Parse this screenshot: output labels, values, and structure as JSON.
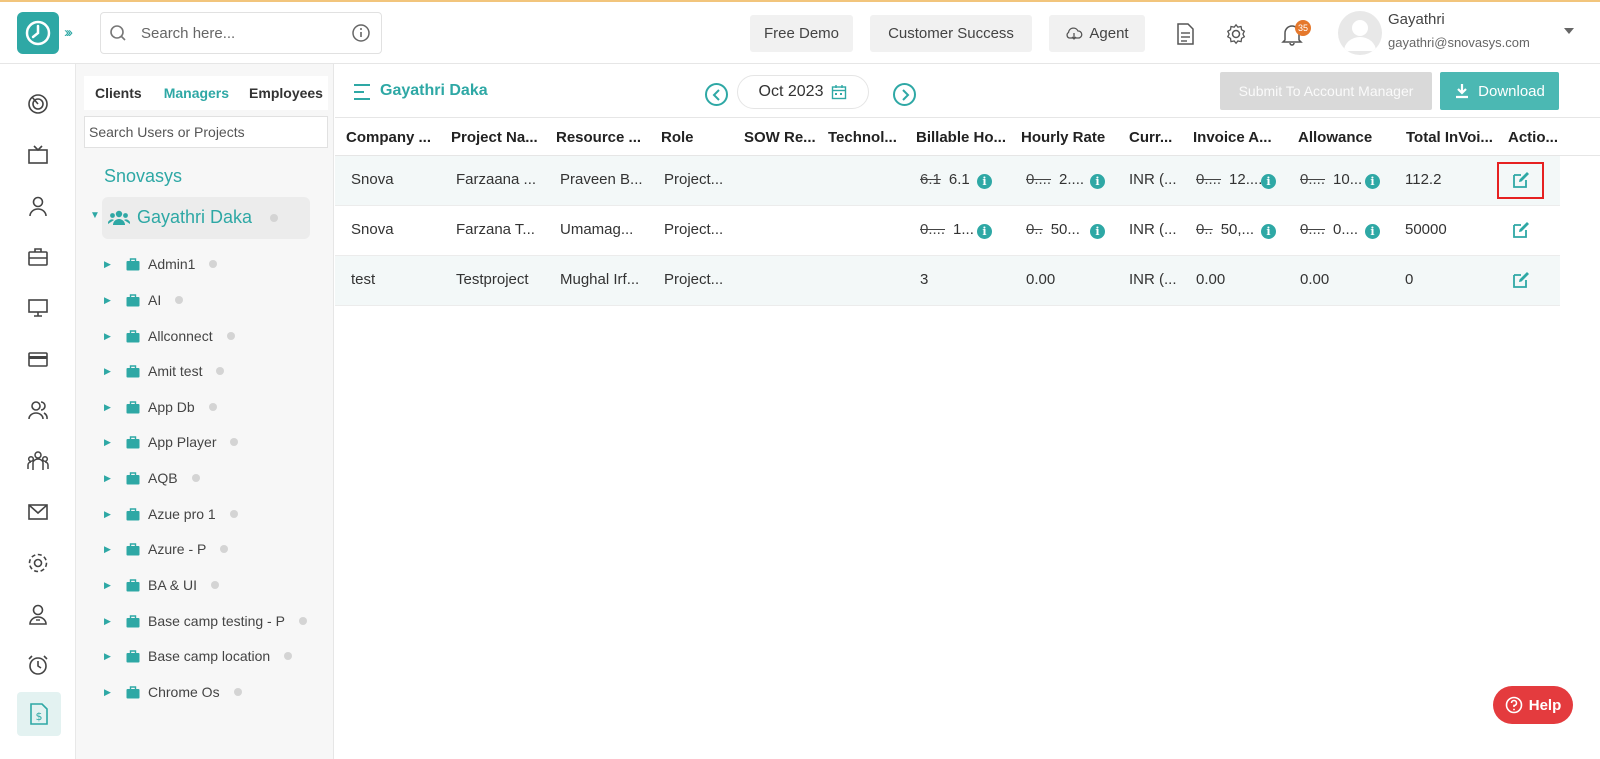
{
  "topbar": {
    "search_placeholder": "Search here...",
    "free_demo": "Free Demo",
    "customer_success": "Customer Success",
    "agent": "Agent",
    "notification_count": "35",
    "user_name": "Gayathri",
    "user_email": "gayathri@snovasys.com"
  },
  "tree": {
    "tabs": [
      "Clients",
      "Managers",
      "Employees"
    ],
    "active_tab": "Managers",
    "search_placeholder": "Search Users or Projects",
    "org": "Snovasys",
    "manager": "Gayathri Daka",
    "projects": [
      "Admin1",
      "AI",
      "Allconnect",
      "Amit test",
      "App Db",
      "App Player",
      "AQB",
      "Azue pro 1",
      "Azure - P",
      "BA & UI",
      "Base camp testing - P",
      "Base camp location",
      "Chrome Os"
    ]
  },
  "main": {
    "title": "Gayathri Daka",
    "month": "Oct 2023",
    "submit_label": "Submit To Account Manager",
    "download_label": "Download",
    "columns": [
      "Company ...",
      "Project Na...",
      "Resource ...",
      "Role",
      "SOW Re...",
      "Technol...",
      "Billable Ho...",
      "Hourly Rate",
      "Curr...",
      "Invoice A...",
      "Allowance",
      "Total InVoi...",
      "Actio..."
    ],
    "rows": [
      {
        "company": "Snova",
        "project": "Farzaana ...",
        "resource": "Praveen B...",
        "role": "Project...",
        "billable_old": "6.1",
        "billable": "6.1",
        "rate_old": "0....",
        "rate": "2....",
        "currency": "INR (...",
        "invoice_old": "0....",
        "invoice": "12....",
        "allowance_old": "0....",
        "allowance": "10...",
        "total": "112.2"
      },
      {
        "company": "Snova",
        "project": "Farzana T...",
        "resource": "Umamag...",
        "role": "Project...",
        "billable_old": "0....",
        "billable": "1...",
        "rate_old": "0..",
        "rate": "50...",
        "currency": "INR (...",
        "invoice_old": "0..",
        "invoice": "50,...",
        "allowance_old": "0....",
        "allowance": "0....",
        "total": "50000"
      },
      {
        "company": "test",
        "project": "Testproject",
        "resource": "Mughal Irf...",
        "role": "Project...",
        "billable": "3",
        "rate": "0.00",
        "currency": "INR (...",
        "invoice": "0.00",
        "allowance": "0.00",
        "total": "0"
      }
    ]
  },
  "help_label": "Help",
  "colors": {
    "accent": "#2ea8a5",
    "highlight": "#e62121",
    "help": "#e43b3e",
    "badge": "#e5782c"
  }
}
